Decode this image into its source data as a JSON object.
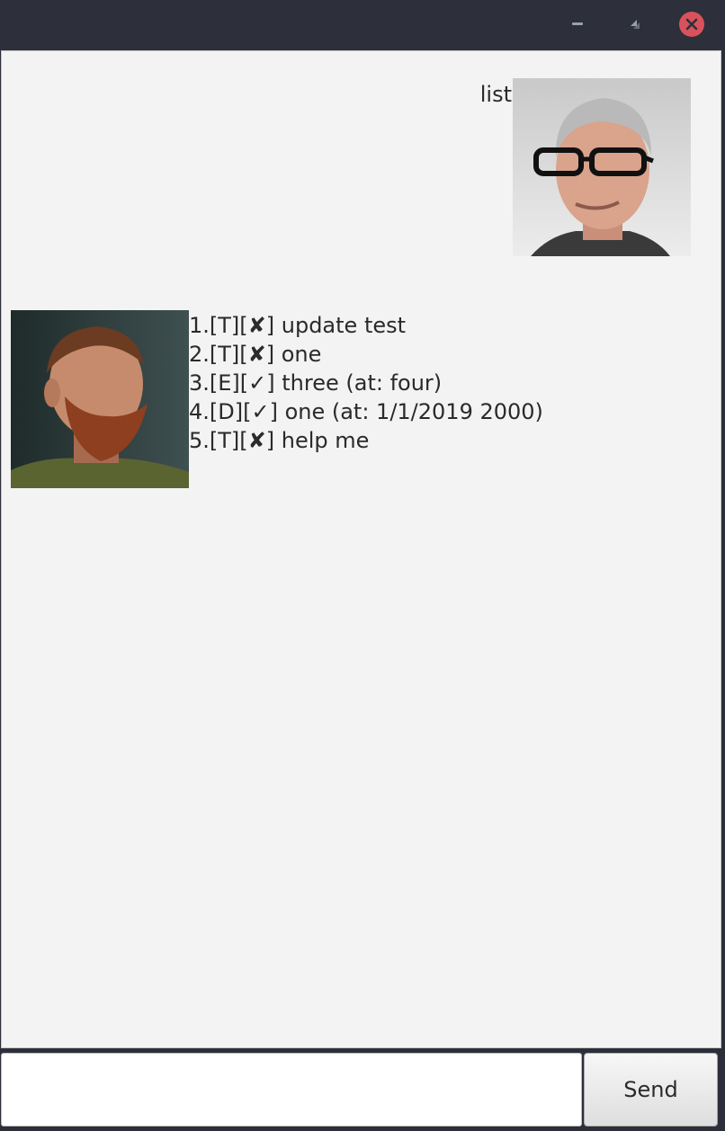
{
  "window": {
    "controls": {
      "minimize_icon": "minimize-icon",
      "maximize_icon": "maximize-icon",
      "close_icon": "close-icon",
      "close_color": "#d9525b"
    }
  },
  "chat": {
    "user_message": {
      "text": "list",
      "avatar": "user-avatar-photo"
    },
    "bot_message": {
      "avatar": "bot-avatar-photo",
      "lines": [
        "1.[T][✘] update test",
        "2.[T][✘] one",
        "3.[E][✓] three (at: four)",
        "4.[D][✓] one (at: 1/1/2019 2000)",
        "5.[T][✘] help me"
      ]
    }
  },
  "input": {
    "value": "",
    "placeholder": "",
    "send_label": "Send"
  }
}
